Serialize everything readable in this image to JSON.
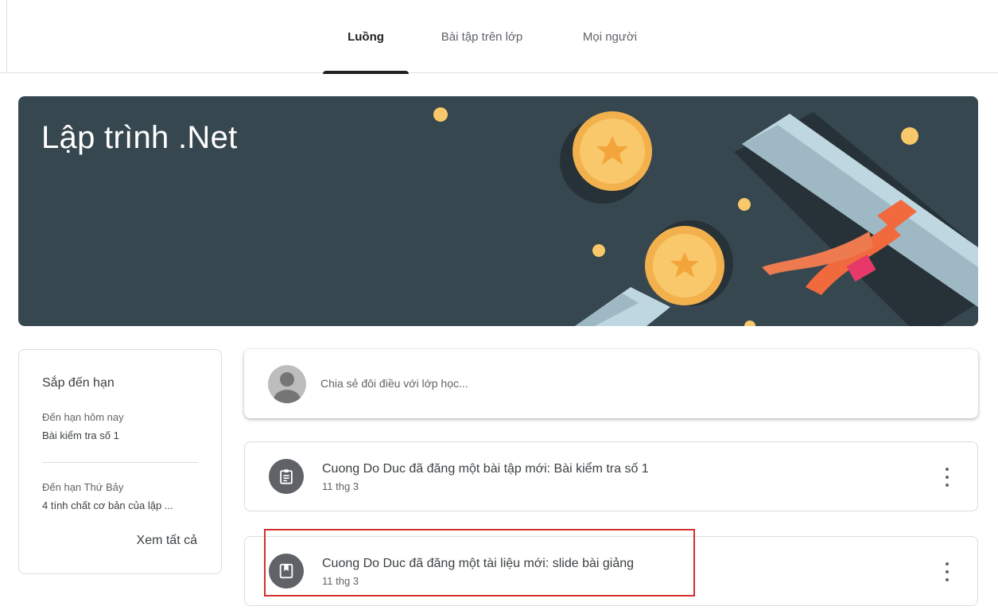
{
  "nav": {
    "tabs": [
      {
        "label": "Luồng",
        "active": true
      },
      {
        "label": "Bài tập trên lớp",
        "active": false
      },
      {
        "label": "Mọi người",
        "active": false
      }
    ]
  },
  "banner": {
    "title": "Lập trình .Net",
    "background_color": "#37474f"
  },
  "upcoming": {
    "heading": "Sắp đến hạn",
    "groups": [
      {
        "due_label": "Đến hạn hôm nay",
        "item": "Bài kiểm tra số 1"
      },
      {
        "due_label": "Đến hạn Thứ Bảy",
        "item": "4 tính chất cơ bản của lập ..."
      }
    ],
    "view_all": "Xem tất cả"
  },
  "share": {
    "placeholder": "Chia sẻ đôi điều với lớp học..."
  },
  "posts": [
    {
      "icon": "assignment-icon",
      "title": "Cuong Do Duc đã đăng một bài tập mới: Bài kiểm tra số 1",
      "date": "11 thg 3"
    },
    {
      "icon": "material-icon",
      "title": "Cuong Do Duc đã đăng một tài liệu mới: slide bài giảng",
      "date": "11 thg 3"
    }
  ],
  "colors": {
    "highlight_border": "#d32f2f",
    "icon_circle": "#5f6368",
    "active_tab_underline": "#202124"
  }
}
